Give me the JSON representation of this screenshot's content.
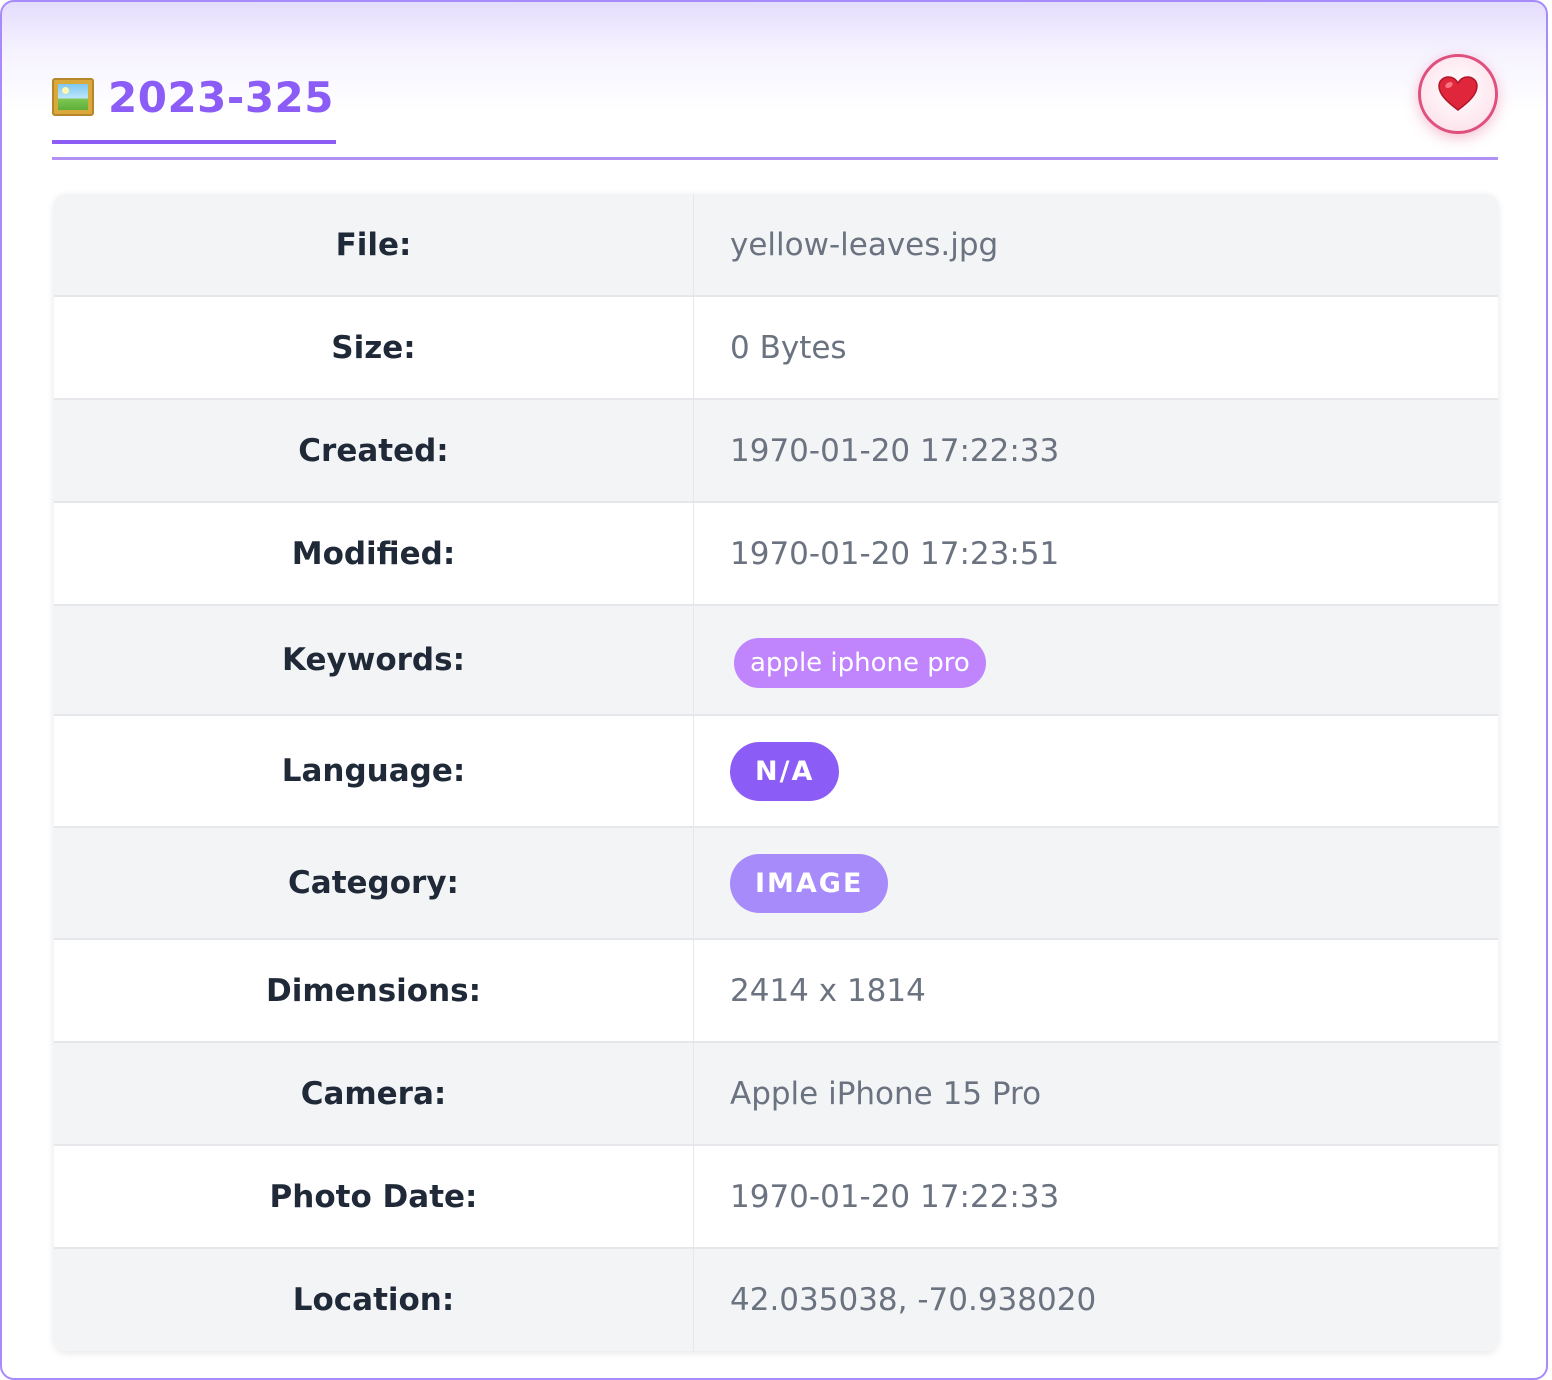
{
  "header": {
    "title": "2023-325",
    "title_icon": "framed-picture-icon",
    "favorite_icon": "heart-icon",
    "favorite_symbol": "❤️"
  },
  "details": {
    "file_label": "File:",
    "file_value": "yellow-leaves.jpg",
    "size_label": "Size:",
    "size_value": "0 Bytes",
    "created_label": "Created:",
    "created_value": "1970-01-20 17:22:33",
    "modified_label": "Modified:",
    "modified_value": "1970-01-20 17:23:51",
    "keywords_label": "Keywords:",
    "keywords": [
      "apple iphone pro"
    ],
    "language_label": "Language:",
    "language_value": "N/A",
    "category_label": "Category:",
    "category_value": "IMAGE",
    "dimensions_label": "Dimensions:",
    "dimensions_value": "2414 x 1814",
    "camera_label": "Camera:",
    "camera_value": "Apple iPhone 15 Pro",
    "photo_date_label": "Photo Date:",
    "photo_date_value": "1970-01-20 17:22:33",
    "location_label": "Location:",
    "location_value": "42.035038, -70.938020"
  },
  "colors": {
    "accent": "#8b5cf6",
    "keyword_tag": "#c084fc",
    "category_pill": "#a78bfa",
    "favorite_ring": "#e0507e"
  }
}
